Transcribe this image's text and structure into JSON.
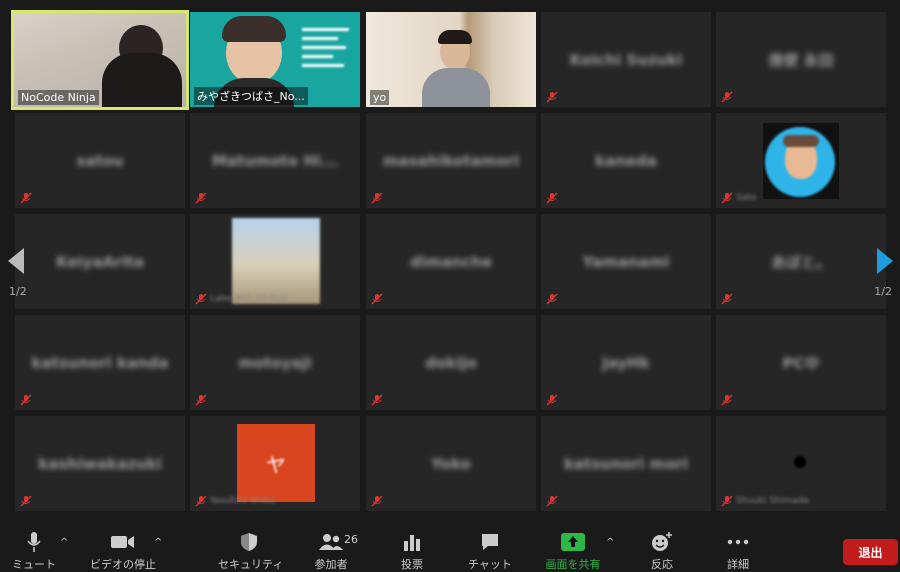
{
  "pager": {
    "left": "1/2",
    "right": "1/2"
  },
  "tiles": {
    "t0": {
      "label": "NoCode Ninja"
    },
    "t1": {
      "label": "みやざきつばさ_No..."
    },
    "t2": {
      "label": "yo"
    },
    "t3": {
      "name": "Koichi Suzuki"
    },
    "t4": {
      "name": "傍使 永田"
    },
    "t5": {
      "name": "satou"
    },
    "t6": {
      "name": "Matumoto  Hi..."
    },
    "t7": {
      "name": "masahikotamori"
    },
    "t8": {
      "name": "kaneda"
    },
    "t9": {
      "small": "Sato"
    },
    "t10": {
      "name": "KeiyaArita"
    },
    "t11": {
      "small": "Labo IMG 3D Ray"
    },
    "t12": {
      "name": "dimanche"
    },
    "t13": {
      "name": "Yamanami"
    },
    "t14": {
      "name": "あぼと。"
    },
    "t15": {
      "name": "katsunori kanda"
    },
    "t16": {
      "name": "motoyaji"
    },
    "t17": {
      "name": "dokijo"
    },
    "t18": {
      "name": "JayHk"
    },
    "t19": {
      "name": "PC中"
    },
    "t20": {
      "name": "kashiwakazuki"
    },
    "t21": {
      "avatar_letter": "ヤ",
      "small": "Yasuhiro Shiba"
    },
    "t22": {
      "name": "Yoko"
    },
    "t23": {
      "name": "katsunori mori"
    },
    "t24": {
      "small": "Shuuki Shimada"
    }
  },
  "toolbar": {
    "mute": "ミュート",
    "video": "ビデオの停止",
    "security": "セキュリティ",
    "participants": "参加者",
    "participants_count": "26",
    "poll": "投票",
    "chat": "チャット",
    "share": "画面を共有",
    "reactions": "反応",
    "more": "詳細",
    "leave": "退出"
  },
  "colors": {
    "active_border": "#d8e66a",
    "share_green": "#2fb648",
    "leave_red": "#c21b1b",
    "nav_blue": "#1e9bdc"
  }
}
